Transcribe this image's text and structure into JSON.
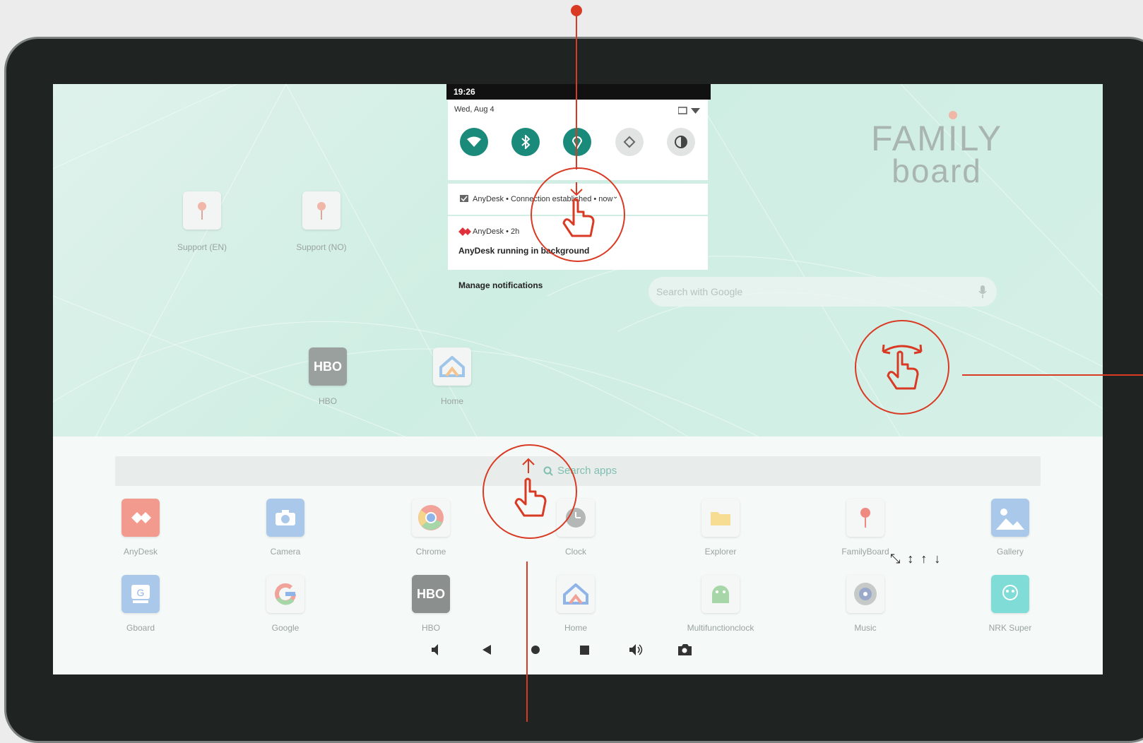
{
  "status_bar": {
    "time": "19:26"
  },
  "quick_settings": {
    "date": "Wed, Aug 4",
    "tiles": [
      {
        "name": "wifi-icon",
        "active": true
      },
      {
        "name": "bluetooth-icon",
        "active": true
      },
      {
        "name": "location-icon",
        "active": true
      },
      {
        "name": "auto-rotate-icon",
        "active": false
      },
      {
        "name": "invert-colors-icon",
        "active": false
      }
    ]
  },
  "notifications": [
    {
      "app": "AnyDesk",
      "header": "AnyDesk • Connection established • now"
    },
    {
      "app": "AnyDesk",
      "header": "AnyDesk • 2h",
      "body": "AnyDesk running in background"
    }
  ],
  "manage_notifications": "Manage notifications",
  "home": {
    "brand_line1": "FAMILY",
    "brand_line2": "board",
    "search_placeholder": "Search with Google",
    "shortcuts": [
      {
        "label": "Support (EN)"
      },
      {
        "label": "Support (NO)"
      },
      {
        "label": "HBO"
      },
      {
        "label": "Home"
      }
    ]
  },
  "drawer": {
    "search_placeholder": "Search apps",
    "row1": [
      "AnyDesk",
      "Camera",
      "Chrome",
      "Clock",
      "Explorer",
      "FamilyBoard",
      "Gallery"
    ],
    "row2": [
      "Gboard",
      "Google",
      "HBO",
      "Home",
      "Multifunctionclock",
      "Music",
      "NRK Super"
    ],
    "hbo_text": "HBO"
  },
  "window_controls": [
    "shrink-icon",
    "resize-vertical-icon",
    "arrow-up-icon",
    "arrow-down-icon"
  ],
  "nav_bar": [
    "volume-down-icon",
    "back-icon",
    "home-icon",
    "recents-icon",
    "volume-up-icon",
    "screenshot-icon"
  ],
  "colors": {
    "accent": "#1a8a7a",
    "annotation": "#d93a24",
    "frame": "#1f2321"
  }
}
